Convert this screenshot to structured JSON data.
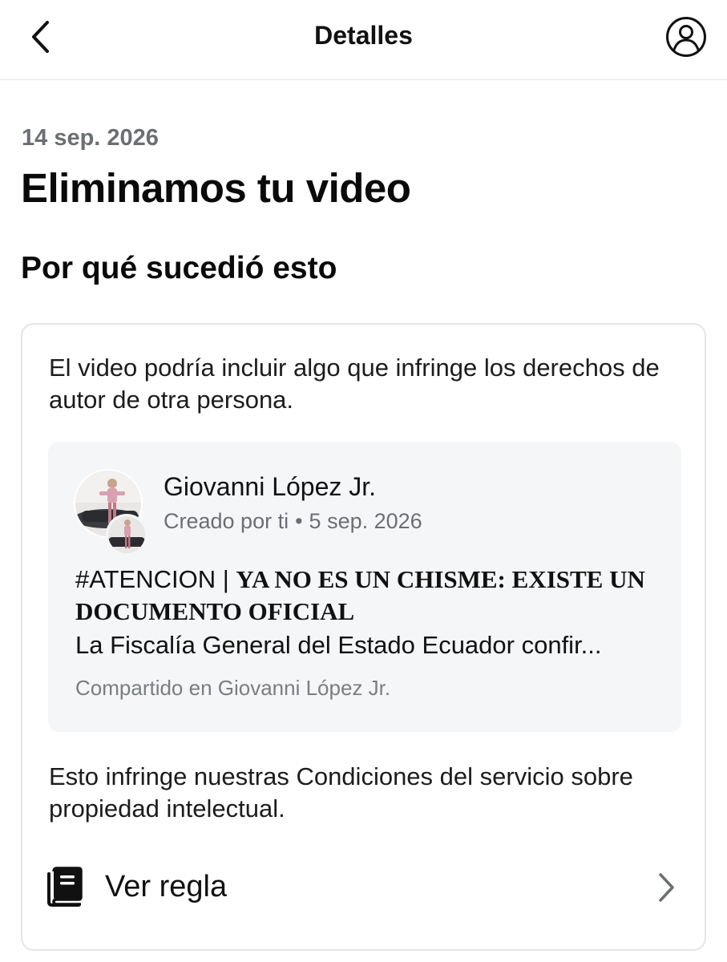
{
  "header": {
    "title": "Detalles",
    "back_icon": "chevron-left-icon",
    "profile_icon": "person-circle-icon"
  },
  "notice": {
    "date": "14 sep. 2026",
    "title": "Eliminamos tu video",
    "section_title": "Por qué sucedió esto"
  },
  "card": {
    "reason": "El video podría incluir algo que infringe los derechos de autor de otra persona.",
    "post": {
      "author": "Giovanni López Jr.",
      "created": "Creado por ti",
      "separator": "•",
      "date": "5 sep. 2026",
      "hashtag": "#ATENCION | ",
      "headline": "YA NO ES UN CHISME: EXISTE UN DOCUMENTO OFICIAL",
      "excerpt": "La Fiscalía General del Estado Ecuador confir...",
      "shared_in": "Compartido en Giovanni López Jr."
    },
    "policy": "Esto infringe nuestras Condiciones del servicio sobre propiedad intelectual.",
    "rule_link": {
      "label": "Ver regla",
      "icon": "book-icon",
      "chevron_icon": "chevron-right-icon"
    }
  }
}
